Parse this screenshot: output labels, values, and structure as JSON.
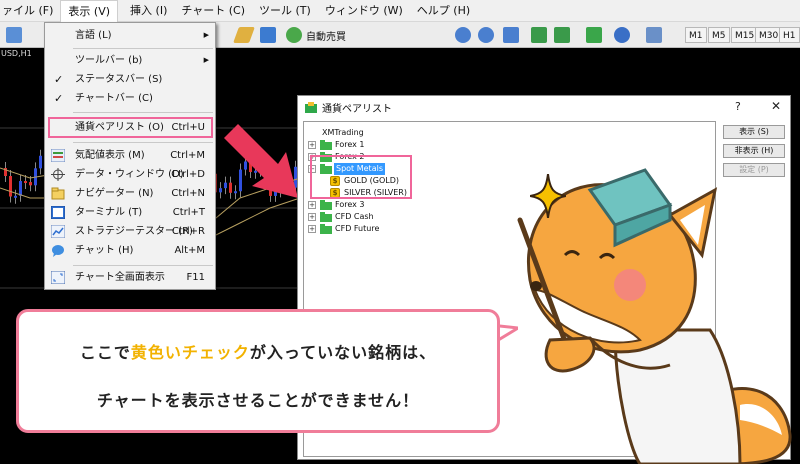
{
  "menubar": {
    "items": [
      "ァイル (F)",
      "表示 (V)",
      "挿入 (I)",
      "チャート (C)",
      "ツール (T)",
      "ウィンドウ (W)",
      "ヘルプ (H)"
    ]
  },
  "toolbar": {
    "auto_trade_label": "自動売買",
    "timeframes": [
      "M1",
      "M5",
      "M15",
      "M30",
      "H1"
    ]
  },
  "chart": {
    "symbol_label": "USD,H1"
  },
  "view_menu": {
    "items": [
      {
        "label": "言語 (L)",
        "shortcut": "",
        "submenu": true
      },
      {
        "label": "ツールバー (b)",
        "shortcut": "",
        "submenu": true
      },
      {
        "label": "ステータスバー (S)",
        "shortcut": "",
        "checked": true
      },
      {
        "label": "チャートバー (C)",
        "shortcut": "",
        "checked": true
      },
      {
        "label": "通貨ペアリスト (O)",
        "shortcut": "Ctrl+U",
        "icon": "symbols-icon"
      },
      {
        "label": "気配値表示 (M)",
        "shortcut": "Ctrl+M",
        "icon": "market-watch-icon"
      },
      {
        "label": "データ・ウィンドウ (D)",
        "shortcut": "Ctrl+D",
        "icon": "crosshair-icon"
      },
      {
        "label": "ナビゲーター (N)",
        "shortcut": "Ctrl+N",
        "icon": "navigator-icon"
      },
      {
        "label": "ターミナル (T)",
        "shortcut": "Ctrl+T",
        "icon": "terminal-icon"
      },
      {
        "label": "ストラテジーテスター (R)",
        "shortcut": "Ctrl+R",
        "icon": "tester-icon"
      },
      {
        "label": "チャット (H)",
        "shortcut": "Alt+M",
        "icon": "chat-icon"
      },
      {
        "label": "チャート全画面表示",
        "shortcut": "F11",
        "icon": "fullscreen-icon"
      }
    ]
  },
  "dialog": {
    "title": "通貨ペアリスト",
    "help": "?",
    "close": "✕",
    "tree": [
      {
        "label": "XMTrading"
      },
      {
        "label": "Forex 1"
      },
      {
        "label": "Forex 2"
      },
      {
        "label": "Spot Metals"
      },
      {
        "label": "GOLD  (GOLD)"
      },
      {
        "label": "SILVER  (SILVER)"
      },
      {
        "label": "Forex 3"
      },
      {
        "label": "CFD Cash"
      },
      {
        "label": "CFD Future"
      }
    ],
    "buttons": {
      "show": "表示 (S)",
      "hide": "非表示 (H)",
      "settings": "設定 (P)"
    }
  },
  "bubble": {
    "line1_pre": "ここで",
    "line1_highlight": "黄色いチェック",
    "line1_post": "が入っていない銘柄は、",
    "line2": "チャートを表示させることができません！"
  },
  "colors": {
    "highlight_border": "#f0659a",
    "arrow": "#e8385a",
    "bubble_border": "#f07d99",
    "highlight_text": "#f2b200",
    "fox": "#f6a640"
  }
}
